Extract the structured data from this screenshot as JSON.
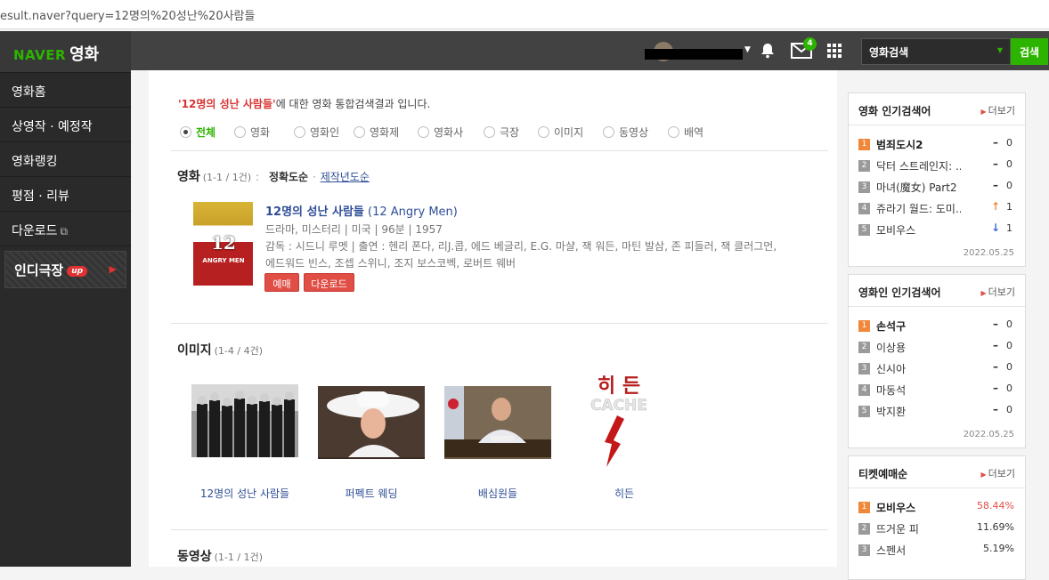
{
  "url": "esult.naver?query=12명의%20성난%20사람들",
  "logo": {
    "naver": "NAVER",
    "movie": "영화"
  },
  "sidebar": {
    "items": [
      {
        "label": "영화홈"
      },
      {
        "label": "상영작 · 예정작"
      },
      {
        "label": "영화랭킹"
      },
      {
        "label": "평점 · 리뷰"
      },
      {
        "label": "다운로드"
      }
    ],
    "indie": {
      "label": "인디극장",
      "badge": "up"
    }
  },
  "topbar": {
    "mail_count": "4",
    "search_select": "영화검색",
    "search_button": "검색"
  },
  "summary": {
    "query": "'12명의 성난 사람들'",
    "text": "에 대한 영화 통합검색결과 입니다."
  },
  "filters": [
    {
      "label": "전체",
      "selected": true
    },
    {
      "label": "영화",
      "selected": false
    },
    {
      "label": "영화인",
      "selected": false
    },
    {
      "label": "영화제",
      "selected": false
    },
    {
      "label": "영화사",
      "selected": false
    },
    {
      "label": "극장",
      "selected": false
    },
    {
      "label": "이미지",
      "selected": false
    },
    {
      "label": "동영상",
      "selected": false
    },
    {
      "label": "배역",
      "selected": false
    }
  ],
  "movie_section": {
    "title": "영화",
    "count": "(1-1 / 1건)",
    "colon": ":",
    "sort_accuracy": "정확도순",
    "sep": "·",
    "sort_year": "제작년도순",
    "movie": {
      "poster_title": "12",
      "poster_sub": "ANGRY MEN",
      "title": "12명의 성난 사람들",
      "eng_title": "(12 Angry Men)",
      "info": "드라마, 미스터리  |  미국  |  96분  |  1957",
      "cast_line1": "감독 : 시드니 루멧  |  출연 : 헨리 폰다, 리J.콥, 에드 베글리, E.G. 마샬, 잭 워든, 마틴 발삼, 존 피들러, 잭 클러그먼,",
      "cast_line2": "에드워드 빈스, 조셉 스위니, 조지 보스코벡, 로버트 웨버",
      "btn_reserve": "예매",
      "btn_download": "다운로드"
    }
  },
  "image_section": {
    "title": "이미지",
    "count": "(1-4 / 4건)",
    "items": [
      {
        "caption": "12명의 성난 사람들"
      },
      {
        "caption": "퍼펙트 웨딩"
      },
      {
        "caption": "배심원들"
      },
      {
        "caption": "히든"
      }
    ],
    "hidden_poster_title": "히 든",
    "hidden_poster_sub": "CACHE"
  },
  "video_section": {
    "title": "동영상",
    "count": "(1-1 / 1건)"
  },
  "panels": {
    "movie_rank": {
      "title": "영화 인기검색어",
      "more": "더보기",
      "date": "2022.05.25",
      "items": [
        {
          "rank": "1",
          "name": "범죄도시2",
          "change": "–",
          "value": "0"
        },
        {
          "rank": "2",
          "name": "닥터 스트레인지: ..",
          "change": "–",
          "value": "0"
        },
        {
          "rank": "3",
          "name": "마녀(魔女) Part2 ..",
          "change": "–",
          "value": "0"
        },
        {
          "rank": "4",
          "name": "쥬라기 월드: 도미..",
          "change": "↑",
          "value": "1"
        },
        {
          "rank": "5",
          "name": "모비우스",
          "change": "↓",
          "value": "1"
        }
      ]
    },
    "person_rank": {
      "title": "영화인 인기검색어",
      "more": "더보기",
      "date": "2022.05.25",
      "items": [
        {
          "rank": "1",
          "name": "손석구",
          "change": "–",
          "value": "0"
        },
        {
          "rank": "2",
          "name": "이상용",
          "change": "–",
          "value": "0"
        },
        {
          "rank": "3",
          "name": "신시아",
          "change": "–",
          "value": "0"
        },
        {
          "rank": "4",
          "name": "마동석",
          "change": "–",
          "value": "0"
        },
        {
          "rank": "5",
          "name": "박지환",
          "change": "–",
          "value": "0"
        }
      ]
    },
    "ticket_rank": {
      "title": "티켓예매순",
      "more": "더보기",
      "items": [
        {
          "rank": "1",
          "name": "모비우스",
          "pct": "58.44%"
        },
        {
          "rank": "2",
          "name": "뜨거운 피",
          "pct": "11.69%"
        },
        {
          "rank": "3",
          "name": "스펜서",
          "pct": "5.19%"
        }
      ]
    }
  },
  "colors": {
    "naver_green": "#2db400",
    "accent_red": "#e04e45",
    "link_blue": "#2f4e97"
  }
}
